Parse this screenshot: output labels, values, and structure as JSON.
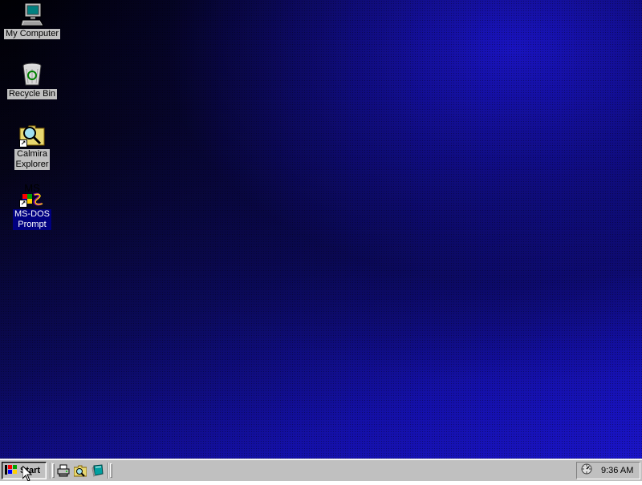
{
  "desktop": {
    "icons": [
      {
        "name": "my-computer",
        "label": "My Computer",
        "icon": "computer-icon",
        "selected": false
      },
      {
        "name": "recycle-bin",
        "label": "Recycle Bin",
        "icon": "recycle-bin-icon",
        "selected": false
      },
      {
        "name": "calmira-explorer",
        "label": "Calmira\nExplorer",
        "icon": "folder-magnifier-icon",
        "selected": false
      },
      {
        "name": "ms-dos-prompt",
        "label": "MS-DOS\nPrompt",
        "icon": "ms-dos-icon",
        "selected": true
      }
    ],
    "ms_dos_icon_text": "MS"
  },
  "taskbar": {
    "start_label": "Start",
    "quick_launch": [
      {
        "name": "quick-launch-printer",
        "icon": "printer-icon"
      },
      {
        "name": "quick-launch-explorer",
        "icon": "explorer-icon"
      },
      {
        "name": "quick-launch-help",
        "icon": "book-icon"
      }
    ],
    "tray": {
      "clock": "9:36 AM",
      "icon": "scheduler-icon"
    }
  },
  "colors": {
    "taskbar": "#c0c0c0",
    "selection": "#000080",
    "desktop_dark": "#000004",
    "desktop_bright": "#1a14c8"
  }
}
